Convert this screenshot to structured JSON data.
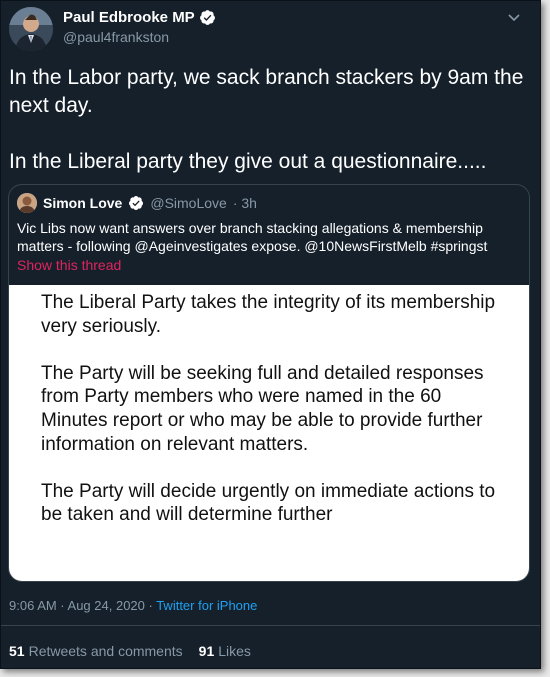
{
  "author": {
    "display_name": "Paul Edbrooke MP",
    "handle": "@paul4frankston"
  },
  "tweet": {
    "paragraphs": [
      "In the Labor party, we sack branch stackers by 9am the next day.",
      "In the Liberal party they give out a questionnaire....."
    ]
  },
  "quoted": {
    "display_name": "Simon Love",
    "handle": "@SimoLove",
    "time": "· 3h",
    "text": "Vic Libs now want answers over branch stacking allegations & membership matters - following @Ageinvestigates expose. @10NewsFirstMelb #springst",
    "show_thread": "Show this thread",
    "image_paragraphs": [
      "The Liberal Party takes the integrity of its membership very seriously.",
      "The Party will be seeking full and detailed responses from Party members who were named in the 60 Minutes report or who may be able to provide further information on relevant matters.",
      "The Party will decide urgently on immediate actions to be taken and will determine further"
    ]
  },
  "meta": {
    "timestamp": "9:06 AM · Aug 24, 2020 · ",
    "source": "Twitter for iPhone"
  },
  "stats": {
    "retweets_count": "51",
    "retweets_label": "Retweets and comments",
    "likes_count": "91",
    "likes_label": "Likes"
  },
  "colors": {
    "background": "#15202b",
    "secondary_text": "#8899a6",
    "link": "#1da1f2",
    "show_thread": "#e0245e",
    "verified": "#ffffff"
  },
  "icons": {
    "verified": "verified-badge-icon",
    "menu": "chevron-down-icon"
  }
}
